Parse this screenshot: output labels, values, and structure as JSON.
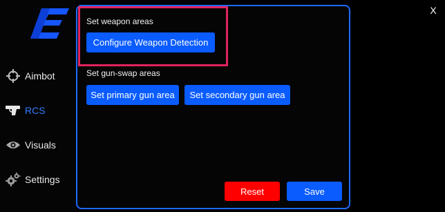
{
  "window": {
    "close_label": "X"
  },
  "sidebar": {
    "logo_icon": "e-logo-icon",
    "items": [
      {
        "label": "Aimbot",
        "icon": "crosshair-icon",
        "active": false
      },
      {
        "label": "RCS",
        "icon": "pistol-icon",
        "active": true
      },
      {
        "label": "Visuals",
        "icon": "eye-icon",
        "active": false
      },
      {
        "label": "Settings",
        "icon": "gear-icon",
        "active": false
      }
    ]
  },
  "main": {
    "weapon_areas_label": "Set weapon areas",
    "configure_button": "Configure Weapon Detection",
    "gun_swap_label": "Set gun-swap areas",
    "primary_button": "Set primary gun area",
    "secondary_button": "Set secondary gun area",
    "reset_button": "Reset",
    "save_button": "Save"
  },
  "colors": {
    "accent": "#0a5cff",
    "active_nav": "#2f7dff",
    "panel_border": "#1f6bff",
    "reset": "#ff0000",
    "highlight": "#e0245e",
    "background": "#000000"
  }
}
